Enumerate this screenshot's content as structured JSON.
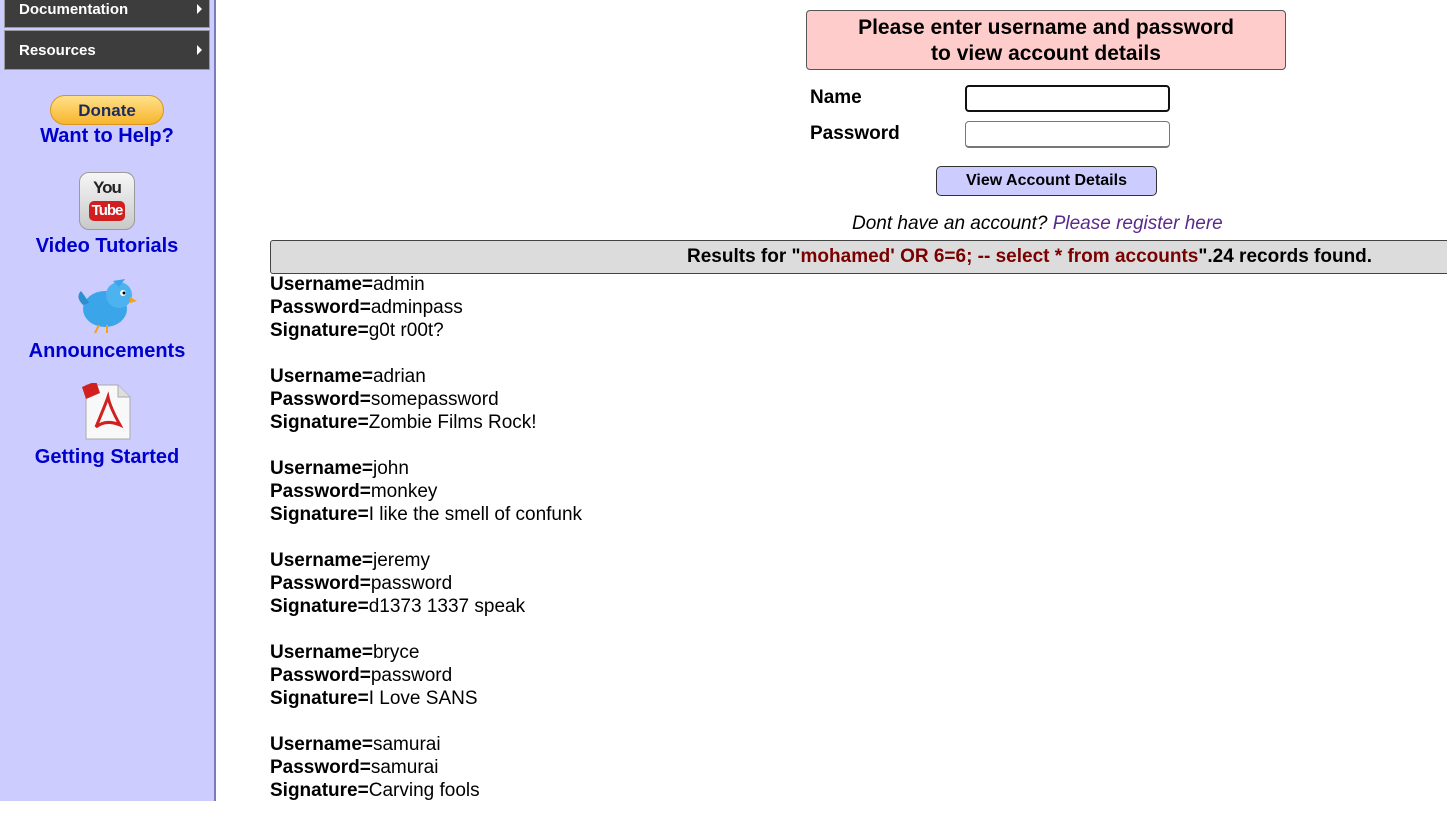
{
  "sidebar": {
    "menu": [
      {
        "label": "Documentation"
      },
      {
        "label": "Resources"
      }
    ],
    "donate": {
      "button": "Donate",
      "link": "Want to Help?"
    },
    "video": {
      "you": "You",
      "tube": "Tube",
      "link": "Video Tutorials"
    },
    "announcements": {
      "link": "Announcements"
    },
    "getting_started": {
      "link": "Getting Started"
    }
  },
  "login": {
    "header_line1": "Please enter username and password",
    "header_line2": "to view account details",
    "name_label": "Name",
    "password_label": "Password",
    "name_value": "",
    "password_value": "",
    "submit_label": "View Account Details",
    "register_prompt": "Dont have an account?",
    "register_link": "Please register here"
  },
  "results": {
    "prefix": "Results for \"",
    "query": "mohamed' OR 6=6; -- select * from accounts",
    "suffix": "\".24 records found.",
    "field_labels": {
      "username": "Username=",
      "password": "Password=",
      "signature": "Signature="
    },
    "records": [
      {
        "username": "admin",
        "password": "adminpass",
        "signature": "g0t r00t?"
      },
      {
        "username": "adrian",
        "password": "somepassword",
        "signature": "Zombie Films Rock!"
      },
      {
        "username": "john",
        "password": "monkey",
        "signature": "I like the smell of confunk"
      },
      {
        "username": "jeremy",
        "password": "password",
        "signature": "d1373 1337 speak"
      },
      {
        "username": "bryce",
        "password": "password",
        "signature": "I Love SANS"
      },
      {
        "username": "samurai",
        "password": "samurai",
        "signature": "Carving fools"
      }
    ]
  },
  "colors": {
    "sidebar_bg": "#ccccff",
    "header_bg": "#ffcccc",
    "query_color": "#7a0000",
    "link_color": "#0000cc"
  }
}
